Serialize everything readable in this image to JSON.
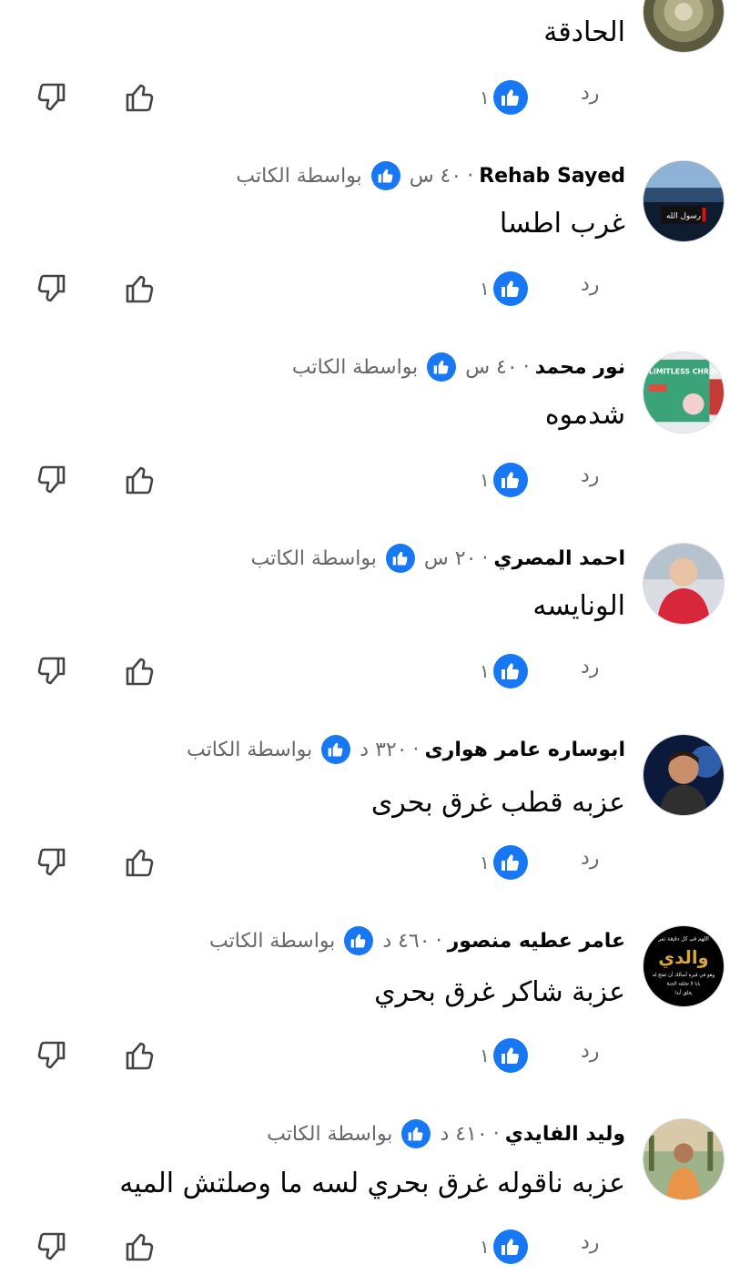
{
  "top_comment": {
    "body": "الحادقة",
    "reply_label": "رد",
    "reaction_count": "١"
  },
  "comments": [
    {
      "author": "Rehab Sayed",
      "time": "٤٠ س",
      "by_author": "بواسطة الكاتب",
      "body": "غرب اطسا",
      "reply_label": "رد",
      "reaction_count": "١"
    },
    {
      "author": "نور محمد",
      "time": "٤٠ س",
      "by_author": "بواسطة الكاتب",
      "body": "شدموه",
      "reply_label": "رد",
      "reaction_count": "١"
    },
    {
      "author": "احمد المصري",
      "time": "٢٠ س",
      "by_author": "بواسطة الكاتب",
      "body": "الونايسه",
      "reply_label": "رد",
      "reaction_count": "١"
    },
    {
      "author": "ابوساره عامر هوارى",
      "time": "٣٢٠ د",
      "by_author": "بواسطة الكاتب",
      "body": "عزبه قطب غرق بحرى",
      "reply_label": "رد",
      "reaction_count": "١"
    },
    {
      "author": "عامر عطيه منصور",
      "time": "٤٦٠ د",
      "by_author": "بواسطة الكاتب",
      "body": "عزبة شاكر غرق بحري",
      "reply_label": "رد",
      "reaction_count": "١"
    },
    {
      "author": "وليد الفايدي",
      "time": "٤١٠ د",
      "by_author": "بواسطة الكاتب",
      "body": "عزبه ناقوله غرق بحري لسه ما وصلتش الميه",
      "reply_label": "رد",
      "reaction_count": "١"
    }
  ],
  "avatar_texts": {
    "rehab": "رسول الله",
    "nour": "LIMITLESS CHROMAX",
    "amer_line1": "اللهم في كل دقيقة تمر",
    "amer_main": "والدي",
    "amer_line2": "وهو في قبره أسألك أن تفتح له",
    "amer_line3": "بابا لا تغلقه الجنة",
    "amer_line4": "يغلق أبدا"
  },
  "colors": {
    "accent": "#1877f2",
    "muted": "#65676b",
    "text": "#050505"
  },
  "icons": [
    "like-reaction-icon",
    "thumbs-up-icon",
    "thumbs-down-icon"
  ]
}
